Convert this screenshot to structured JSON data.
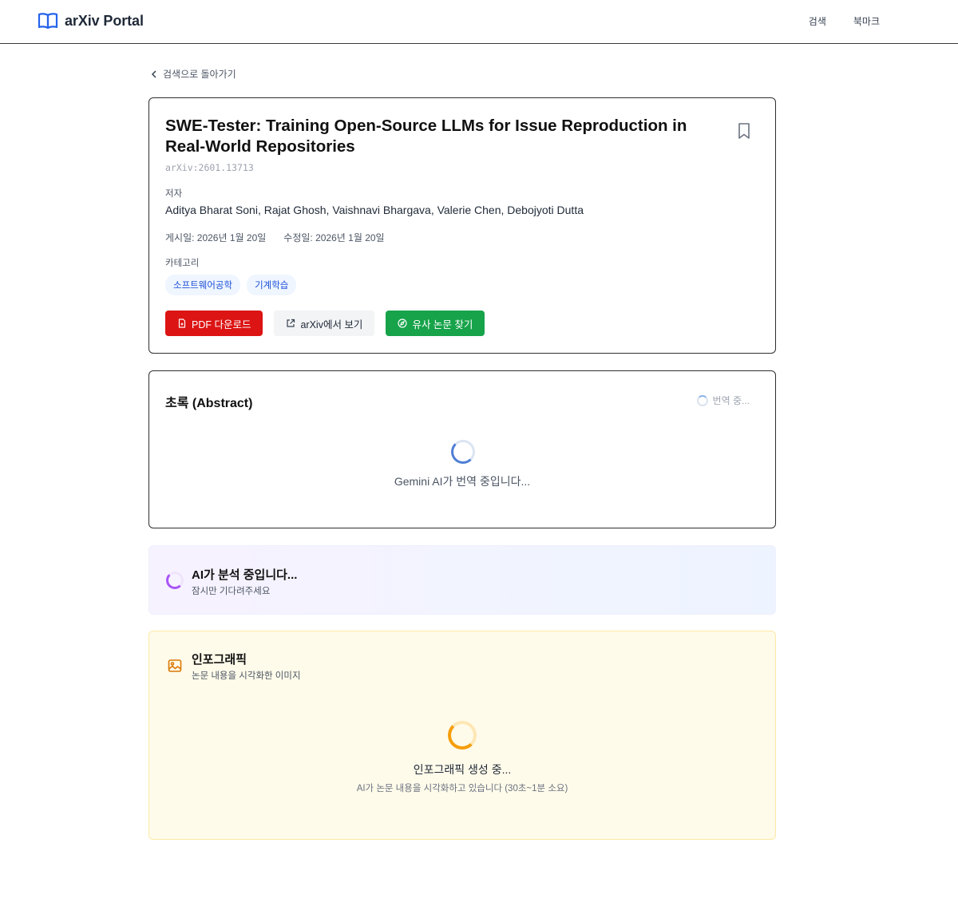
{
  "header": {
    "brand": "arXiv Portal",
    "nav": {
      "search": "검색",
      "bookmarks": "북마크"
    }
  },
  "back_link": "검색으로 돌아가기",
  "paper": {
    "title": "SWE-Tester: Training Open-Source LLMs for Issue Reproduction in Real-World Repositories",
    "arxiv_id": "arXiv:2601.13713",
    "authors_label": "저자",
    "authors": "Aditya Bharat Soni, Rajat Ghosh, Vaishnavi Bhargava, Valerie Chen, Debojyoti Dutta",
    "published": "게시일: 2026년 1월 20일",
    "updated": "수정일: 2026년 1월 20일",
    "categories_label": "카테고리",
    "categories": [
      "소프트웨어공학",
      "기계학습"
    ],
    "actions": {
      "pdf": "PDF 다운로드",
      "arxiv": "arXiv에서 보기",
      "similar": "유사 논문 찾기"
    }
  },
  "abstract": {
    "title": "초록 (Abstract)",
    "translating": "번역 중...",
    "loading": "Gemini AI가 번역 중입니다..."
  },
  "ai_analysis": {
    "title": "AI가 분석 중입니다...",
    "subtitle": "잠시만 기다려주세요"
  },
  "infographic": {
    "title": "인포그래픽",
    "subtitle": "논문 내용을 시각화한 이미지",
    "loading": "인포그래픽 생성 중...",
    "loading_detail": "AI가 논문 내용을 시각화하고 있습니다 (30초~1분 소요)"
  },
  "colors": {
    "pdf_button": "#dc1414",
    "similar_button": "#16a34a",
    "tag_text": "#1d4ed8",
    "brand_icon": "#2563eb"
  }
}
